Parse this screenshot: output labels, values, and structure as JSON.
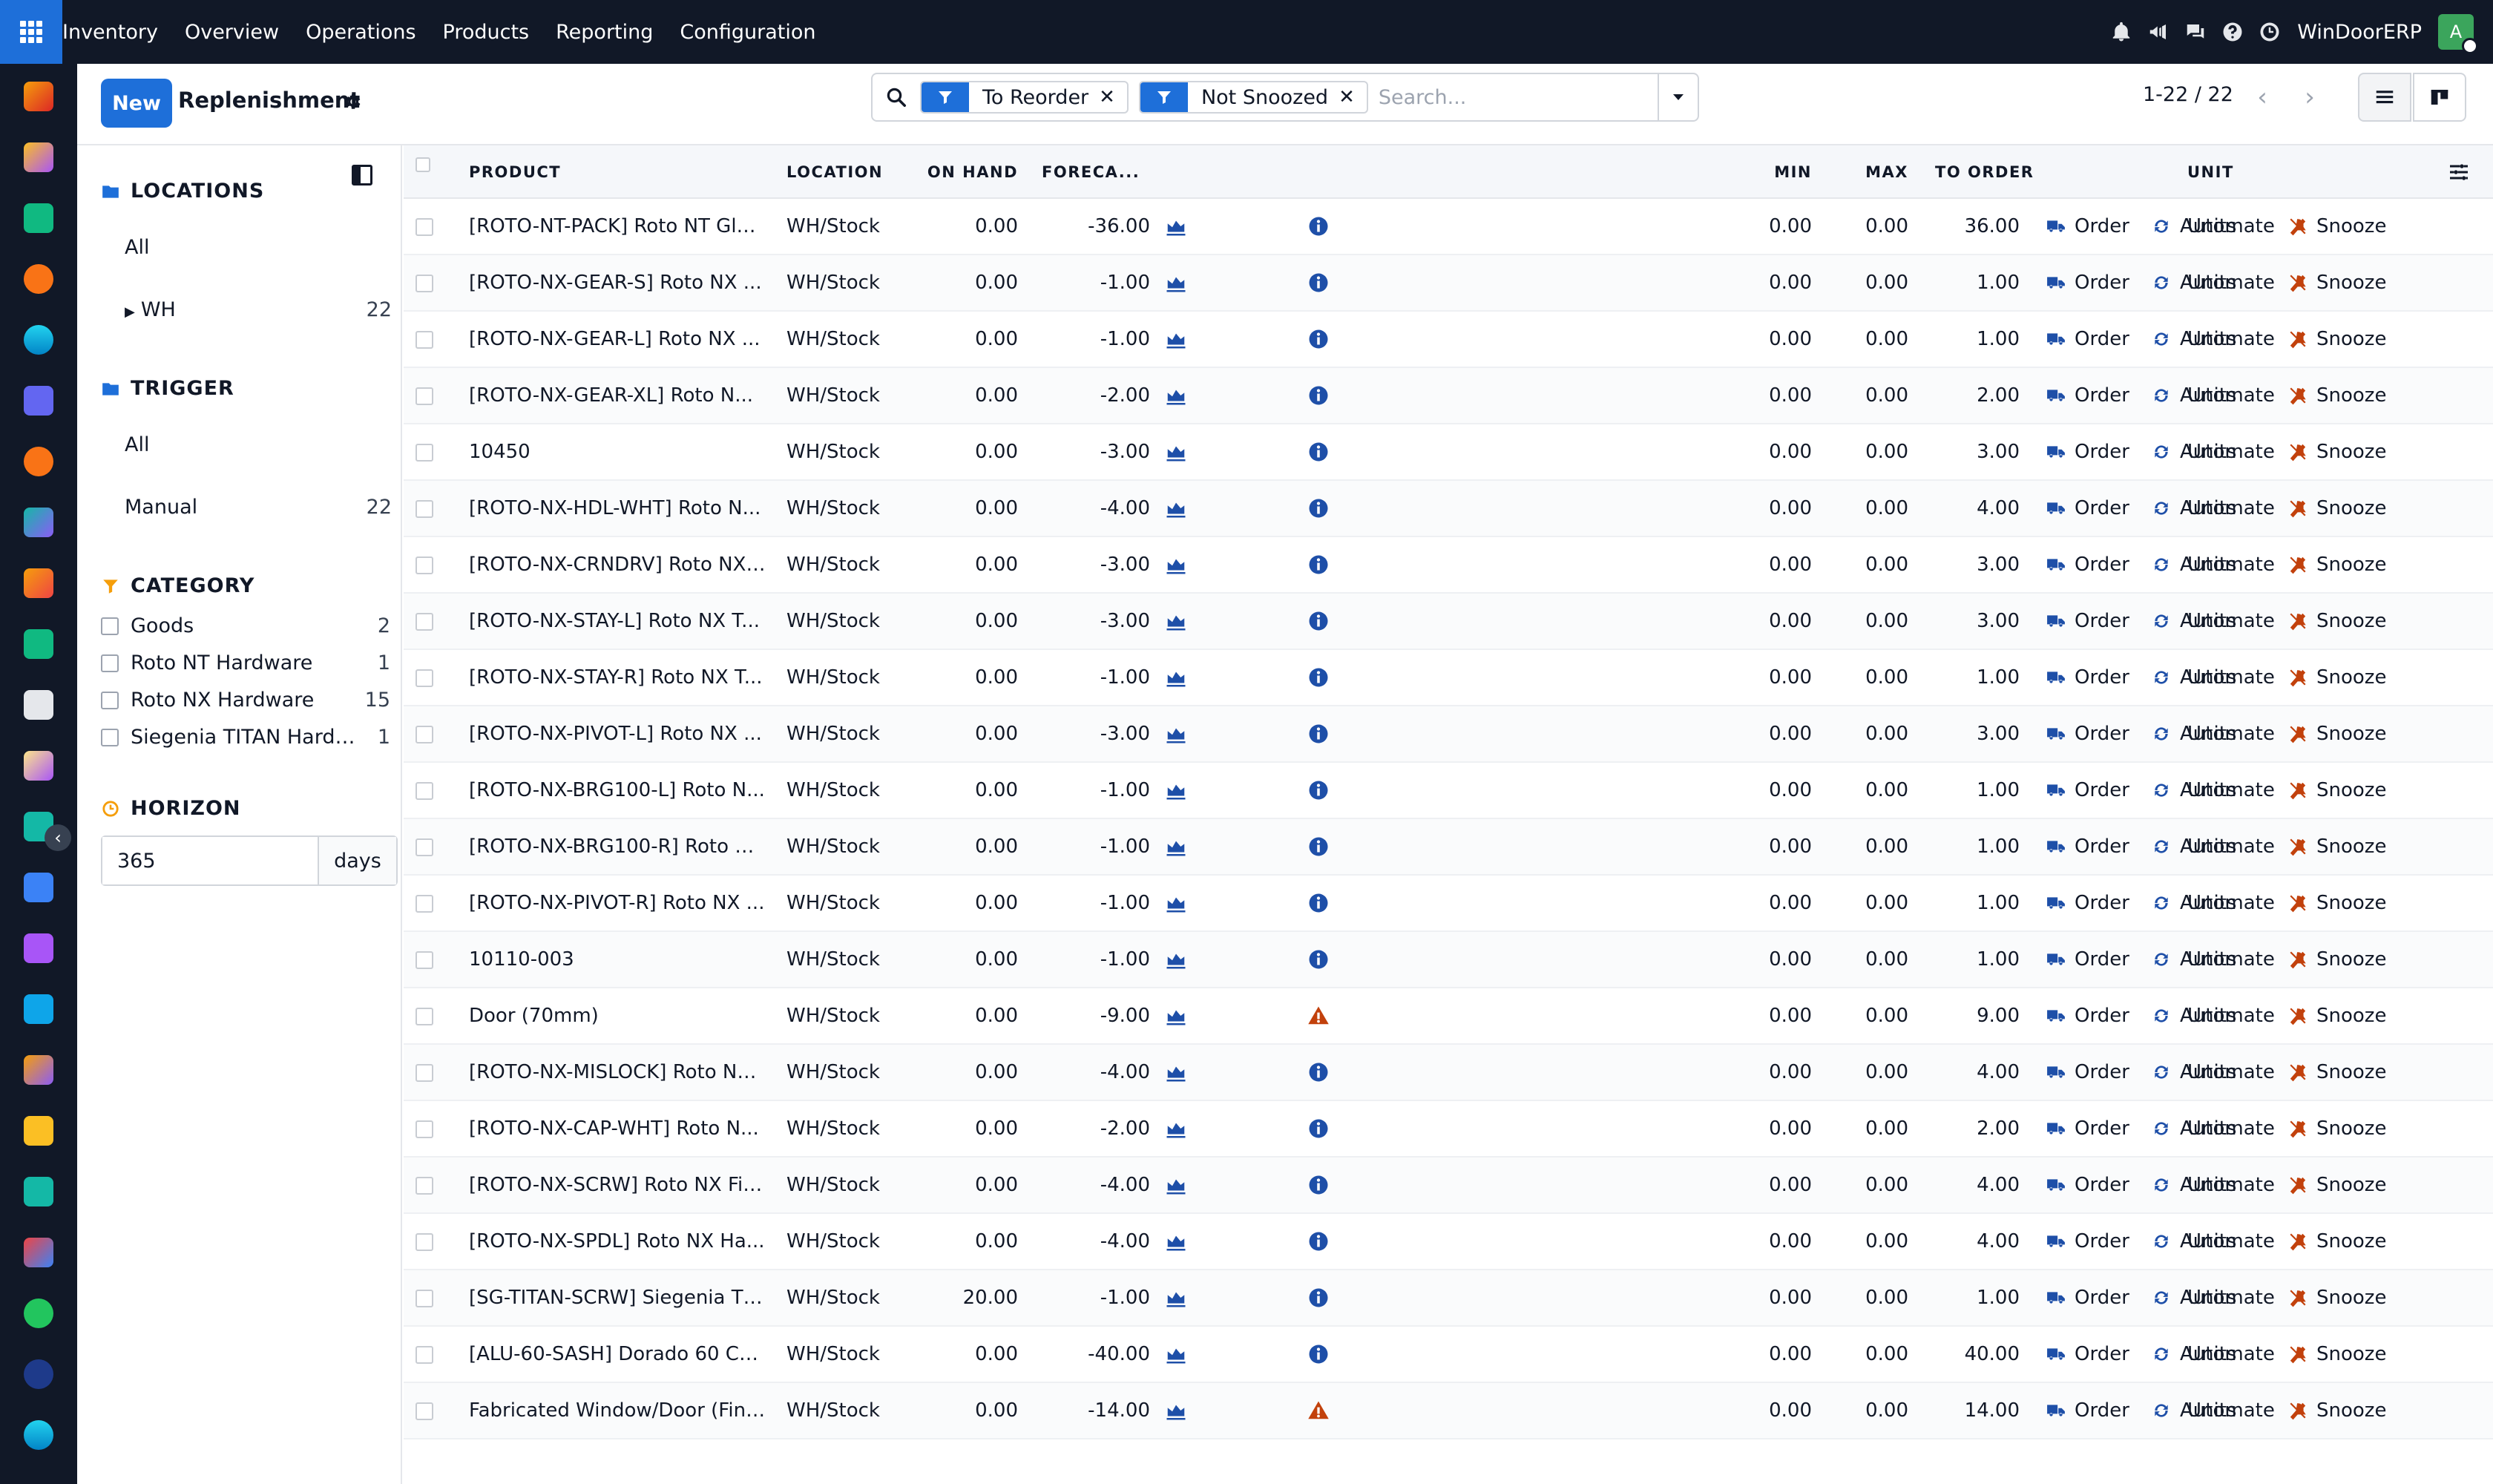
{
  "topbar": {
    "menu": [
      "Inventory",
      "Overview",
      "Operations",
      "Products",
      "Reporting",
      "Configuration"
    ],
    "company": "WinDoorERP",
    "avatar_initial": "A"
  },
  "control": {
    "new_label": "New",
    "title": "Replenishment",
    "facets": [
      "To Reorder",
      "Not Snoozed"
    ],
    "search_placeholder": "Search...",
    "pager": "1-22 / 22"
  },
  "panel": {
    "locations": {
      "title": "LOCATIONS",
      "items": [
        {
          "label": "All",
          "count": ""
        },
        {
          "label": "WH",
          "count": "22"
        }
      ]
    },
    "trigger": {
      "title": "TRIGGER",
      "items": [
        {
          "label": "All",
          "count": ""
        },
        {
          "label": "Manual",
          "count": "22"
        }
      ]
    },
    "category": {
      "title": "CATEGORY",
      "items": [
        {
          "label": "Goods",
          "count": "2"
        },
        {
          "label": "Roto NT Hardware",
          "count": "1"
        },
        {
          "label": "Roto NX Hardware",
          "count": "15"
        },
        {
          "label": "Siegenia TITAN Hardware",
          "count": "1"
        }
      ]
    },
    "horizon": {
      "title": "HORIZON",
      "value": "365",
      "unit": "days"
    }
  },
  "table": {
    "headers": {
      "product": "PRODUCT",
      "location": "LOCATION",
      "on_hand": "ON HAND",
      "forecast": "FORECA...",
      "min": "MIN",
      "max": "MAX",
      "to_order": "TO ORDER",
      "unit": "UNIT"
    },
    "actions": {
      "order": "Order",
      "automate": "Automate",
      "snooze": "Snooze"
    },
    "rows": [
      {
        "product": "[ROTO-NT-PACK] Roto NT Gla...",
        "location": "WH/Stock",
        "on_hand": "0.00",
        "forecast": "-36.00",
        "status": "info",
        "min": "0.00",
        "max": "0.00",
        "to_order": "36.00",
        "unit": "Units"
      },
      {
        "product": "[ROTO-NX-GEAR-S] Roto NX ...",
        "location": "WH/Stock",
        "on_hand": "0.00",
        "forecast": "-1.00",
        "status": "info",
        "min": "0.00",
        "max": "0.00",
        "to_order": "1.00",
        "unit": "Units"
      },
      {
        "product": "[ROTO-NX-GEAR-L] Roto NX ...",
        "location": "WH/Stock",
        "on_hand": "0.00",
        "forecast": "-1.00",
        "status": "info",
        "min": "0.00",
        "max": "0.00",
        "to_order": "1.00",
        "unit": "Units"
      },
      {
        "product": "[ROTO-NX-GEAR-XL] Roto N...",
        "location": "WH/Stock",
        "on_hand": "0.00",
        "forecast": "-2.00",
        "status": "info",
        "min": "0.00",
        "max": "0.00",
        "to_order": "2.00",
        "unit": "Units"
      },
      {
        "product": "10450",
        "location": "WH/Stock",
        "on_hand": "0.00",
        "forecast": "-3.00",
        "status": "info",
        "min": "0.00",
        "max": "0.00",
        "to_order": "3.00",
        "unit": "Units"
      },
      {
        "product": "[ROTO-NX-HDL-WHT] Roto N...",
        "location": "WH/Stock",
        "on_hand": "0.00",
        "forecast": "-4.00",
        "status": "info",
        "min": "0.00",
        "max": "0.00",
        "to_order": "4.00",
        "unit": "Units"
      },
      {
        "product": "[ROTO-NX-CRNDRV] Roto NX ...",
        "location": "WH/Stock",
        "on_hand": "0.00",
        "forecast": "-3.00",
        "status": "info",
        "min": "0.00",
        "max": "0.00",
        "to_order": "3.00",
        "unit": "Units"
      },
      {
        "product": "[ROTO-NX-STAY-L] Roto NX T...",
        "location": "WH/Stock",
        "on_hand": "0.00",
        "forecast": "-3.00",
        "status": "info",
        "min": "0.00",
        "max": "0.00",
        "to_order": "3.00",
        "unit": "Units"
      },
      {
        "product": "[ROTO-NX-STAY-R] Roto NX T...",
        "location": "WH/Stock",
        "on_hand": "0.00",
        "forecast": "-1.00",
        "status": "info",
        "min": "0.00",
        "max": "0.00",
        "to_order": "1.00",
        "unit": "Units"
      },
      {
        "product": "[ROTO-NX-PIVOT-L] Roto NX ...",
        "location": "WH/Stock",
        "on_hand": "0.00",
        "forecast": "-3.00",
        "status": "info",
        "min": "0.00",
        "max": "0.00",
        "to_order": "3.00",
        "unit": "Units"
      },
      {
        "product": "[ROTO-NX-BRG100-L] Roto N...",
        "location": "WH/Stock",
        "on_hand": "0.00",
        "forecast": "-1.00",
        "status": "info",
        "min": "0.00",
        "max": "0.00",
        "to_order": "1.00",
        "unit": "Units"
      },
      {
        "product": "[ROTO-NX-BRG100-R] Roto N...",
        "location": "WH/Stock",
        "on_hand": "0.00",
        "forecast": "-1.00",
        "status": "info",
        "min": "0.00",
        "max": "0.00",
        "to_order": "1.00",
        "unit": "Units"
      },
      {
        "product": "[ROTO-NX-PIVOT-R] Roto NX ...",
        "location": "WH/Stock",
        "on_hand": "0.00",
        "forecast": "-1.00",
        "status": "info",
        "min": "0.00",
        "max": "0.00",
        "to_order": "1.00",
        "unit": "Units"
      },
      {
        "product": "10110-003",
        "location": "WH/Stock",
        "on_hand": "0.00",
        "forecast": "-1.00",
        "status": "info",
        "min": "0.00",
        "max": "0.00",
        "to_order": "1.00",
        "unit": "Units"
      },
      {
        "product": "Door (70mm)",
        "location": "WH/Stock",
        "on_hand": "0.00",
        "forecast": "-9.00",
        "status": "warning",
        "min": "0.00",
        "max": "0.00",
        "to_order": "9.00",
        "unit": "Units"
      },
      {
        "product": "[ROTO-NX-MISLOCK] Roto NX...",
        "location": "WH/Stock",
        "on_hand": "0.00",
        "forecast": "-4.00",
        "status": "info",
        "min": "0.00",
        "max": "0.00",
        "to_order": "4.00",
        "unit": "Units"
      },
      {
        "product": "[ROTO-NX-CAP-WHT] Roto N...",
        "location": "WH/Stock",
        "on_hand": "0.00",
        "forecast": "-2.00",
        "status": "info",
        "min": "0.00",
        "max": "0.00",
        "to_order": "2.00",
        "unit": "Units"
      },
      {
        "product": "[ROTO-NX-SCRW] Roto NX Fix...",
        "location": "WH/Stock",
        "on_hand": "0.00",
        "forecast": "-4.00",
        "status": "info",
        "min": "0.00",
        "max": "0.00",
        "to_order": "4.00",
        "unit": "Units"
      },
      {
        "product": "[ROTO-NX-SPDL] Roto NX Ha...",
        "location": "WH/Stock",
        "on_hand": "0.00",
        "forecast": "-4.00",
        "status": "info",
        "min": "0.00",
        "max": "0.00",
        "to_order": "4.00",
        "unit": "Units"
      },
      {
        "product": "[SG-TITAN-SCRW] Siegenia TI...",
        "location": "WH/Stock",
        "on_hand": "20.00",
        "forecast": "-1.00",
        "status": "info",
        "min": "0.00",
        "max": "0.00",
        "to_order": "1.00",
        "unit": "Units"
      },
      {
        "product": "[ALU-60-SASH] Dorado 60 Ca...",
        "location": "WH/Stock",
        "on_hand": "0.00",
        "forecast": "-40.00",
        "status": "info",
        "min": "0.00",
        "max": "0.00",
        "to_order": "40.00",
        "unit": "Units"
      },
      {
        "product": "Fabricated Window/Door (Finis...",
        "location": "WH/Stock",
        "on_hand": "0.00",
        "forecast": "-14.00",
        "status": "warning",
        "min": "0.00",
        "max": "0.00",
        "to_order": "14.00",
        "unit": "Units"
      }
    ]
  },
  "colors": {
    "primary": "#1e6fd9",
    "topbar": "#111827",
    "info_icon": "#1e4fa8",
    "warning_icon": "#c2410c",
    "snooze_icon": "#c2410c"
  }
}
